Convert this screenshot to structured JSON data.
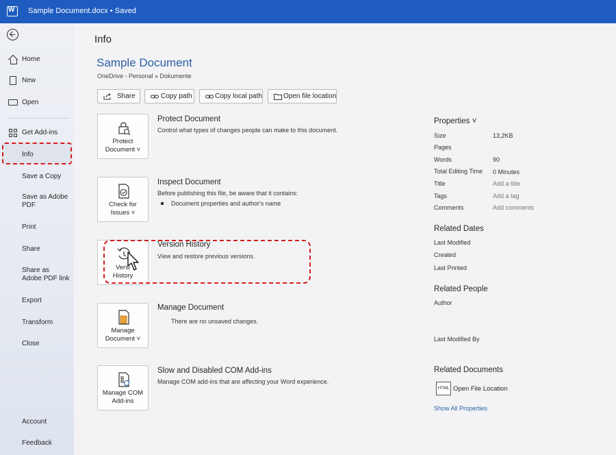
{
  "titlebar": {
    "title": "Sample Document.docx • Saved"
  },
  "sidebar": {
    "items": [
      {
        "label": "Home"
      },
      {
        "label": "New"
      },
      {
        "label": "Open"
      },
      {
        "label": "Get Add-ins"
      },
      {
        "label": "Info"
      },
      {
        "label": "Save a Copy"
      },
      {
        "label": "Save as Adobe PDF"
      },
      {
        "label": "Print"
      },
      {
        "label": "Share"
      },
      {
        "label": "Share as Adobe PDF link"
      },
      {
        "label": "Export"
      },
      {
        "label": "Transform"
      },
      {
        "label": "Close"
      },
      {
        "label": "Account"
      },
      {
        "label": "Feedback"
      }
    ]
  },
  "main": {
    "title": "Info",
    "doc_name": "Sample Document",
    "doc_path": "OneDrive - Personal » Dokumente",
    "buttons": {
      "share": "Share",
      "copy_path": "Copy path",
      "copy_local_path": "Copy local path",
      "open_location": "Open file location"
    },
    "sections": [
      {
        "button_line1": "Protect",
        "button_line2": "Document ˅",
        "title": "Protect Document",
        "desc": "Control what types of changes people can make to this document."
      },
      {
        "button_line1": "Check for",
        "button_line2": "Issues ˅",
        "title": "Inspect Document",
        "desc": "Before publishing this file, be aware that it contains:",
        "bullet": "Document properties and author's name"
      },
      {
        "button_line1": "Versi",
        "button_line2": "History",
        "title": "Version History",
        "desc": "View and restore previous versions."
      },
      {
        "button_line1": "Manage",
        "button_line2": "Document ˅",
        "title": "Manage Document",
        "desc": "There are no unsaved changes."
      },
      {
        "button_line1": "Manage COM",
        "button_line2": "Add-ins",
        "title": "Slow and Disabled COM Add-ins",
        "desc": "Manage COM add-ins that are affecting your Word experience."
      }
    ]
  },
  "properties": {
    "title": "Properties ˅",
    "rows": [
      {
        "label": "Size",
        "value": "13,2KB"
      },
      {
        "label": "Pages",
        "value": ""
      },
      {
        "label": "Words",
        "value": "90"
      },
      {
        "label": "Total Editing Time",
        "value": "0 Minutes"
      },
      {
        "label": "Title",
        "value": "Add a title"
      },
      {
        "label": "Tags",
        "value": "Add a tag"
      },
      {
        "label": "Comments",
        "value": "Add comments"
      }
    ],
    "related_dates": {
      "title": "Related Dates",
      "rows": [
        "Last Modified",
        "Created",
        "Last Printed"
      ]
    },
    "related_people": {
      "title": "Related People",
      "author": "Author",
      "last_modified_by": "Last Modified By"
    },
    "related_documents": {
      "title": "Related Documents",
      "file_icon": "HTML",
      "open_file_location": "Open File Location",
      "show_all": "Show All Properties"
    }
  },
  "colors": {
    "titlebar": "#1f5cc0",
    "accent_text": "#2e5fa5",
    "highlight": "#d51c1c"
  }
}
